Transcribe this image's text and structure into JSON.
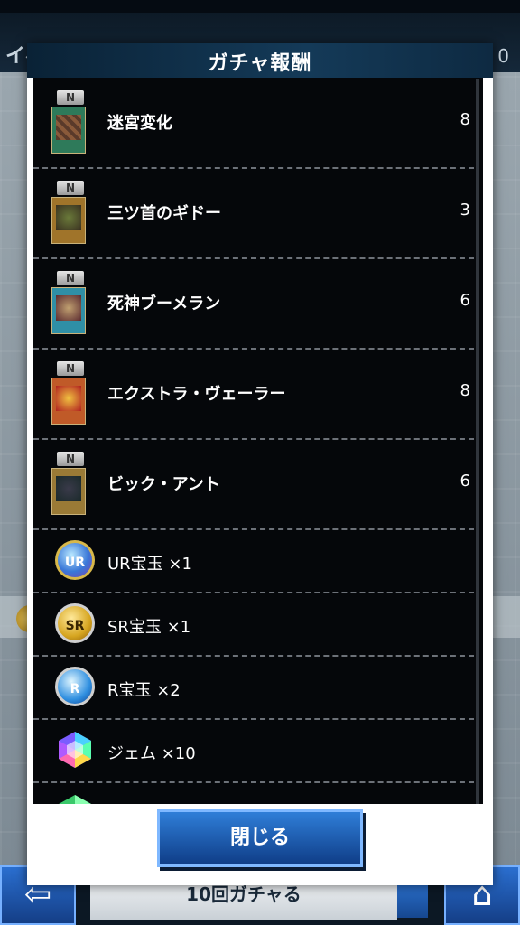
{
  "background": {
    "top_title": "イベント ジ",
    "top_right": "0",
    "bottom_center_label": "10回ガチャる"
  },
  "modal": {
    "title": "ガチャ報酬",
    "close_label": "閉じる"
  },
  "rewards": {
    "cards": [
      {
        "rarity": "N",
        "name": "迷宮変化",
        "qty": "8",
        "color": "#2e7a5a"
      },
      {
        "rarity": "N",
        "name": "三ツ首のギドー",
        "qty": "3",
        "color": "#a0742a"
      },
      {
        "rarity": "N",
        "name": "死神ブーメラン",
        "qty": "6",
        "color": "#2f8fa6"
      },
      {
        "rarity": "N",
        "name": "エクストラ・ヴェーラー",
        "qty": "8",
        "color": "#c05a28"
      },
      {
        "rarity": "N",
        "name": "ビック・アント",
        "qty": "6",
        "color": "#9a7a36"
      }
    ],
    "items": [
      {
        "icon": "ur-orb-icon",
        "icon_text": "UR",
        "name": "UR宝玉 ×1"
      },
      {
        "icon": "sr-orb-icon",
        "icon_text": "SR",
        "name": "SR宝玉 ×1"
      },
      {
        "icon": "r-orb-icon",
        "icon_text": "R",
        "name": "R宝玉 ×2"
      },
      {
        "icon": "gem-icon",
        "icon_text": "",
        "name": "ジェム ×10"
      }
    ]
  }
}
